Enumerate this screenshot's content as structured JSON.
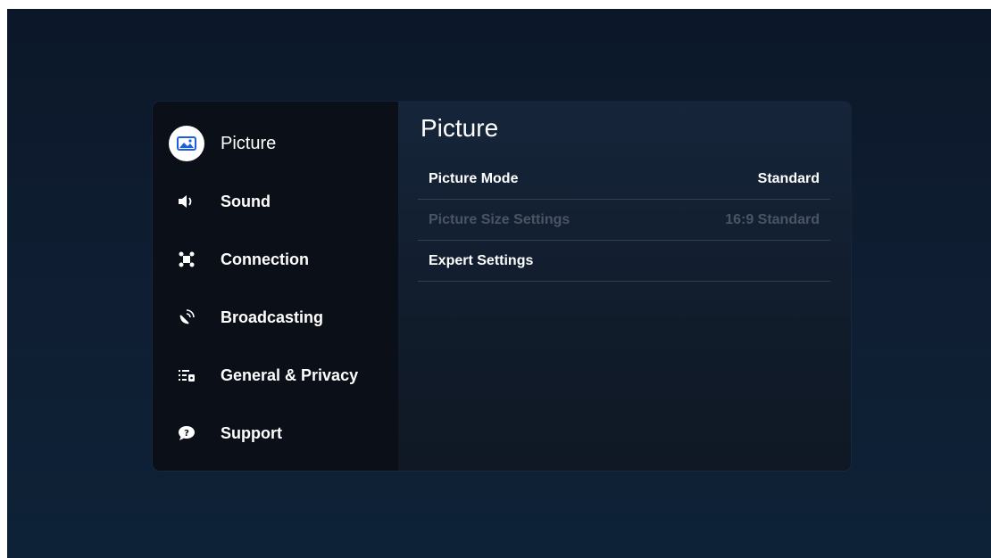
{
  "sidebar": {
    "items": [
      {
        "label": "Picture",
        "icon": "picture-icon",
        "active": true
      },
      {
        "label": "Sound",
        "icon": "speaker-icon"
      },
      {
        "label": "Connection",
        "icon": "connection-icon"
      },
      {
        "label": "Broadcasting",
        "icon": "satellite-icon"
      },
      {
        "label": "General & Privacy",
        "icon": "general-privacy-icon"
      },
      {
        "label": "Support",
        "icon": "support-icon"
      }
    ]
  },
  "content": {
    "title": "Picture",
    "rows": [
      {
        "label": "Picture Mode",
        "value": "Standard",
        "enabled": true
      },
      {
        "label": "Picture Size Settings",
        "value": "16:9 Standard",
        "enabled": false
      },
      {
        "label": "Expert Settings",
        "value": "",
        "enabled": true
      }
    ]
  },
  "colors": {
    "accent": "#1c5fe0",
    "disabled_text": "#4a5564",
    "sidebar_bg": "#0b1018"
  }
}
